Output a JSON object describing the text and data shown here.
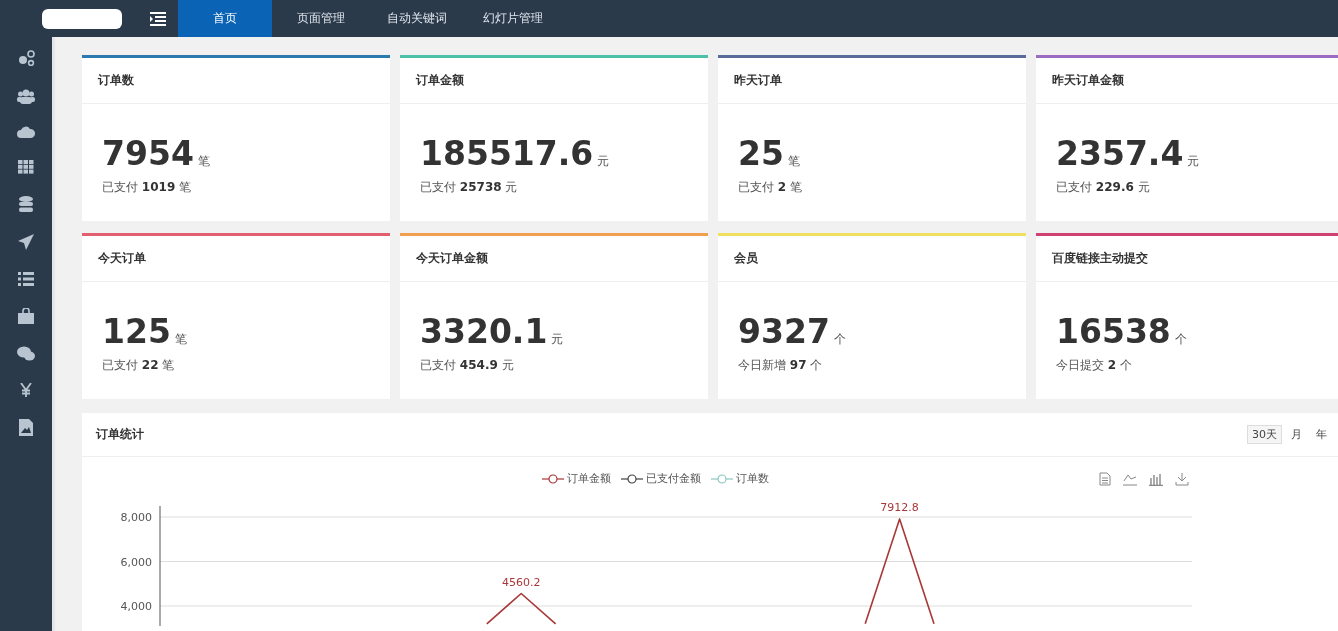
{
  "topbar": {
    "tabs": [
      {
        "label": "首页",
        "selected": true
      },
      {
        "label": "页面管理",
        "selected": false
      },
      {
        "label": "自动关键词",
        "selected": false
      },
      {
        "label": "幻灯片管理",
        "selected": false
      }
    ]
  },
  "sidebar": {
    "items": [
      {
        "kind": "nodes"
      },
      {
        "kind": "users"
      },
      {
        "kind": "cloud"
      },
      {
        "kind": "grid"
      },
      {
        "kind": "database"
      },
      {
        "kind": "plane"
      },
      {
        "kind": "list"
      },
      {
        "kind": "bag"
      },
      {
        "kind": "chat"
      },
      {
        "kind": "yen"
      },
      {
        "kind": "image"
      }
    ]
  },
  "stats": [
    {
      "title": "订单数",
      "value": "7954",
      "unit": "笔",
      "sub_label": "已支付",
      "sub_value": "1019",
      "sub_unit": "笔",
      "color": "#2a7ab0"
    },
    {
      "title": "订单金额",
      "value": "185517.6",
      "unit": "元",
      "sub_label": "已支付",
      "sub_value": "25738",
      "sub_unit": "元",
      "color": "#4fc0a8"
    },
    {
      "title": "昨天订单",
      "value": "25",
      "unit": "笔",
      "sub_label": "已支付",
      "sub_value": "2",
      "sub_unit": "笔",
      "color": "#5a6a9a"
    },
    {
      "title": "昨天订单金额",
      "value": "2357.4",
      "unit": "元",
      "sub_label": "已支付",
      "sub_value": "229.6",
      "sub_unit": "元",
      "color": "#9a6cc0"
    },
    {
      "title": "今天订单",
      "value": "125",
      "unit": "笔",
      "sub_label": "已支付",
      "sub_value": "22",
      "sub_unit": "笔",
      "color": "#e06070"
    },
    {
      "title": "今天订单金额",
      "value": "3320.1",
      "unit": "元",
      "sub_label": "已支付",
      "sub_value": "454.9",
      "sub_unit": "元",
      "color": "#f0a050"
    },
    {
      "title": "会员",
      "value": "9327",
      "unit": "个",
      "sub_label": "今日新增",
      "sub_value": "97",
      "sub_unit": "个",
      "color": "#f0e060"
    },
    {
      "title": "百度链接主动提交",
      "value": "16538",
      "unit": "个",
      "sub_label": "今日提交",
      "sub_value": "2",
      "sub_unit": "个",
      "color": "#d04070"
    }
  ],
  "order_panel": {
    "title": "订单统计",
    "ranges": [
      {
        "label": "30天",
        "selected": true
      },
      {
        "label": "月",
        "selected": false
      },
      {
        "label": "年",
        "selected": false
      }
    ],
    "toolbox": [
      {
        "kind": "data"
      },
      {
        "kind": "line"
      },
      {
        "kind": "bar"
      },
      {
        "kind": "download"
      }
    ],
    "chart_data": {
      "type": "line",
      "ylim": [
        3100,
        8000
      ],
      "yticks": [
        {
          "value": 4000,
          "label": "4,000"
        },
        {
          "value": 6000,
          "label": "6,000"
        },
        {
          "value": 8000,
          "label": "8,000"
        }
      ],
      "value_labels": [
        null,
        null,
        null,
        null,
        null,
        null,
        null,
        null,
        null,
        null,
        "4560.2",
        null,
        null,
        null,
        null,
        null,
        null,
        null,
        null,
        null,
        null,
        "7912.8",
        null,
        null,
        null,
        null,
        null,
        null,
        null,
        null
      ],
      "series": [
        {
          "name": "订单金额",
          "color": "#a83838",
          "values": [
            null,
            null,
            null,
            null,
            null,
            null,
            null,
            null,
            null,
            3200,
            4560.2,
            3200,
            null,
            null,
            null,
            null,
            null,
            null,
            null,
            null,
            3200,
            7912.8,
            3200,
            null,
            null,
            null,
            null,
            null,
            null,
            null
          ]
        },
        {
          "name": "已支付金额",
          "color": "#444444",
          "values": [
            null,
            null,
            null,
            null,
            null,
            null,
            null,
            null,
            null,
            null,
            null,
            null,
            null,
            null,
            null,
            null,
            null,
            null,
            null,
            null,
            null,
            null,
            null,
            null,
            null,
            null,
            null,
            null,
            null,
            null
          ]
        },
        {
          "name": "订单数",
          "color": "#8cc8c0",
          "values": [
            null,
            null,
            null,
            null,
            null,
            null,
            null,
            null,
            null,
            null,
            null,
            null,
            null,
            null,
            null,
            null,
            null,
            null,
            null,
            null,
            null,
            null,
            null,
            null,
            null,
            null,
            null,
            null,
            null,
            null
          ]
        }
      ]
    }
  }
}
